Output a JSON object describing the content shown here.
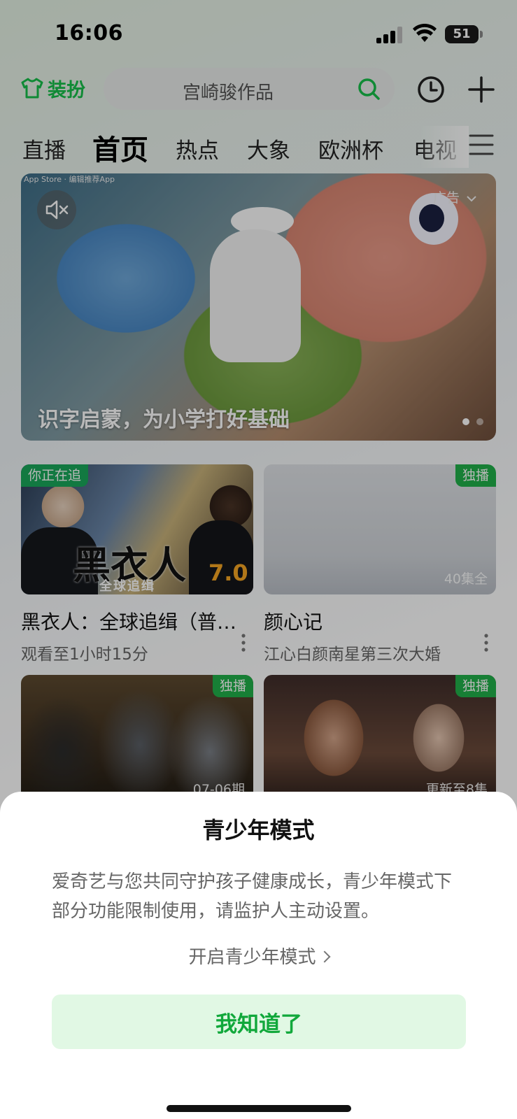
{
  "status_bar": {
    "time": "16:06",
    "battery": "51"
  },
  "top_bar": {
    "dress_label": "装扮",
    "search_placeholder": "宫崎骏作品"
  },
  "tabs": [
    {
      "label": "直播",
      "active": false
    },
    {
      "label": "首页",
      "active": true
    },
    {
      "label": "热点",
      "active": false
    },
    {
      "label": "大象",
      "active": false
    },
    {
      "label": "欧洲杯",
      "active": false
    },
    {
      "label": "电视",
      "active": false
    }
  ],
  "banner": {
    "source_text": "App Store · 编辑推荐App",
    "ad_label": "广告",
    "caption": "识字启蒙，为小学打好基础",
    "dots": 2,
    "active_dot": 0
  },
  "cards": [
    {
      "badge": "你正在追",
      "badge_side": "left",
      "title": "黑衣人：全球追缉（普…",
      "subtitle": "观看至1小时15分",
      "score": "7.0",
      "logo": "黑衣人",
      "logo_sub": "全球追缉",
      "corner": ""
    },
    {
      "badge": "独播",
      "badge_side": "right",
      "title": "颜心记",
      "subtitle": "江心白颜南星第三次大婚",
      "corner": "40集全"
    },
    {
      "badge": "独播",
      "badge_side": "right",
      "corner": "07-06期"
    },
    {
      "badge": "独播",
      "badge_side": "right",
      "corner": "更新至8集"
    }
  ],
  "sheet": {
    "title": "青少年模式",
    "description": "爱奇艺与您共同守护孩子健康成长，青少年模式下部分功能限制使用，请监护人主动设置。",
    "link_label": "开启青少年模式",
    "confirm_label": "我知道了"
  },
  "colors": {
    "brand_green": "#17c04a",
    "badge_green": "#21b14a",
    "button_bg": "#e1f8e4",
    "button_text": "#11a83b"
  }
}
